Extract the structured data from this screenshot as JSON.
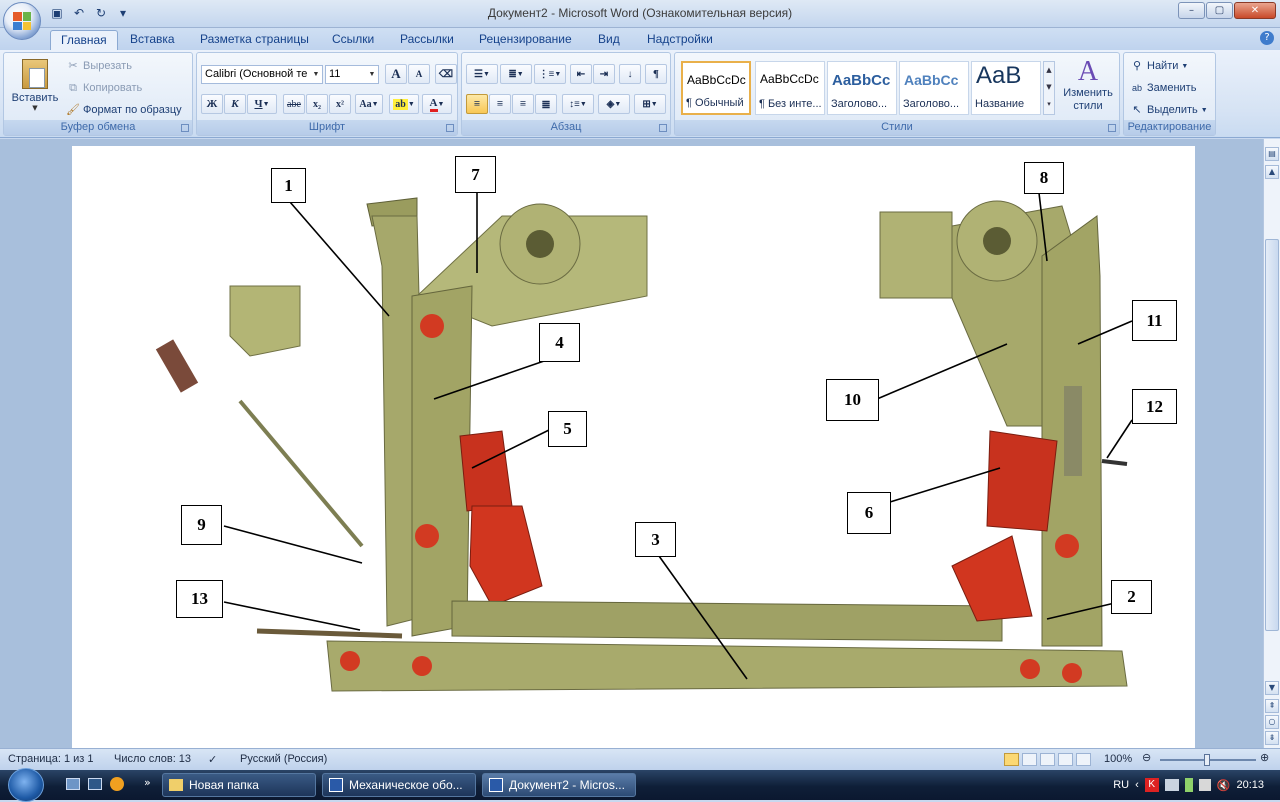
{
  "window": {
    "title": "Документ2 - Microsoft Word (Ознакомительная версия)",
    "controls": {
      "minimize": "–",
      "maximize": "▢",
      "close": "✕"
    }
  },
  "ribbon_tabs": [
    "Главная",
    "Вставка",
    "Разметка страницы",
    "Ссылки",
    "Рассылки",
    "Рецензирование",
    "Вид",
    "Надстройки"
  ],
  "clipboard": {
    "label": "Буфер обмена",
    "paste": "Вставить",
    "cut": "Вырезать",
    "copy": "Копировать",
    "format_painter": "Формат по образцу"
  },
  "font": {
    "label": "Шрифт",
    "name": "Calibri (Основной те",
    "size": "11",
    "bold": "Ж",
    "italic": "К",
    "underline": "Ч",
    "strike": "abe",
    "subscript": "x₂",
    "superscript": "x²",
    "change_case": "Aa",
    "grow": "A",
    "shrink": "A"
  },
  "paragraph": {
    "label": "Абзац"
  },
  "styles": {
    "label": "Стили",
    "items": [
      {
        "sample": "AaBbCcDc",
        "name": "¶ Обычный"
      },
      {
        "sample": "AaBbCcDc",
        "name": "¶ Без инте..."
      },
      {
        "sample": "AaBbCc",
        "name": "Заголово..."
      },
      {
        "sample": "AaBbCc",
        "name": "Заголово..."
      },
      {
        "sample": "AaB",
        "name": "Название"
      }
    ],
    "change_styles": "Изменить стили"
  },
  "editing": {
    "label": "Редактирование",
    "find": "Найти",
    "replace": "Заменить",
    "select": "Выделить"
  },
  "figure": {
    "callouts": [
      "1",
      "2",
      "3",
      "4",
      "5",
      "6",
      "7",
      "8",
      "9",
      "10",
      "11",
      "12",
      "13"
    ]
  },
  "status": {
    "page": "Страница: 1 из 1",
    "words": "Число слов: 13",
    "language": "Русский (Россия)",
    "zoom": "100%"
  },
  "taskbar": {
    "tasks": [
      "Новая папка",
      "Механическое обо...",
      "Документ2 - Micros..."
    ],
    "lang": "RU",
    "time": "20:13"
  },
  "colors": {
    "ribbon": "#dde8f6",
    "brake_body": "#a5a86a",
    "brake_shoe": "#c8321e",
    "selected_style_border": "#e9b04a"
  }
}
